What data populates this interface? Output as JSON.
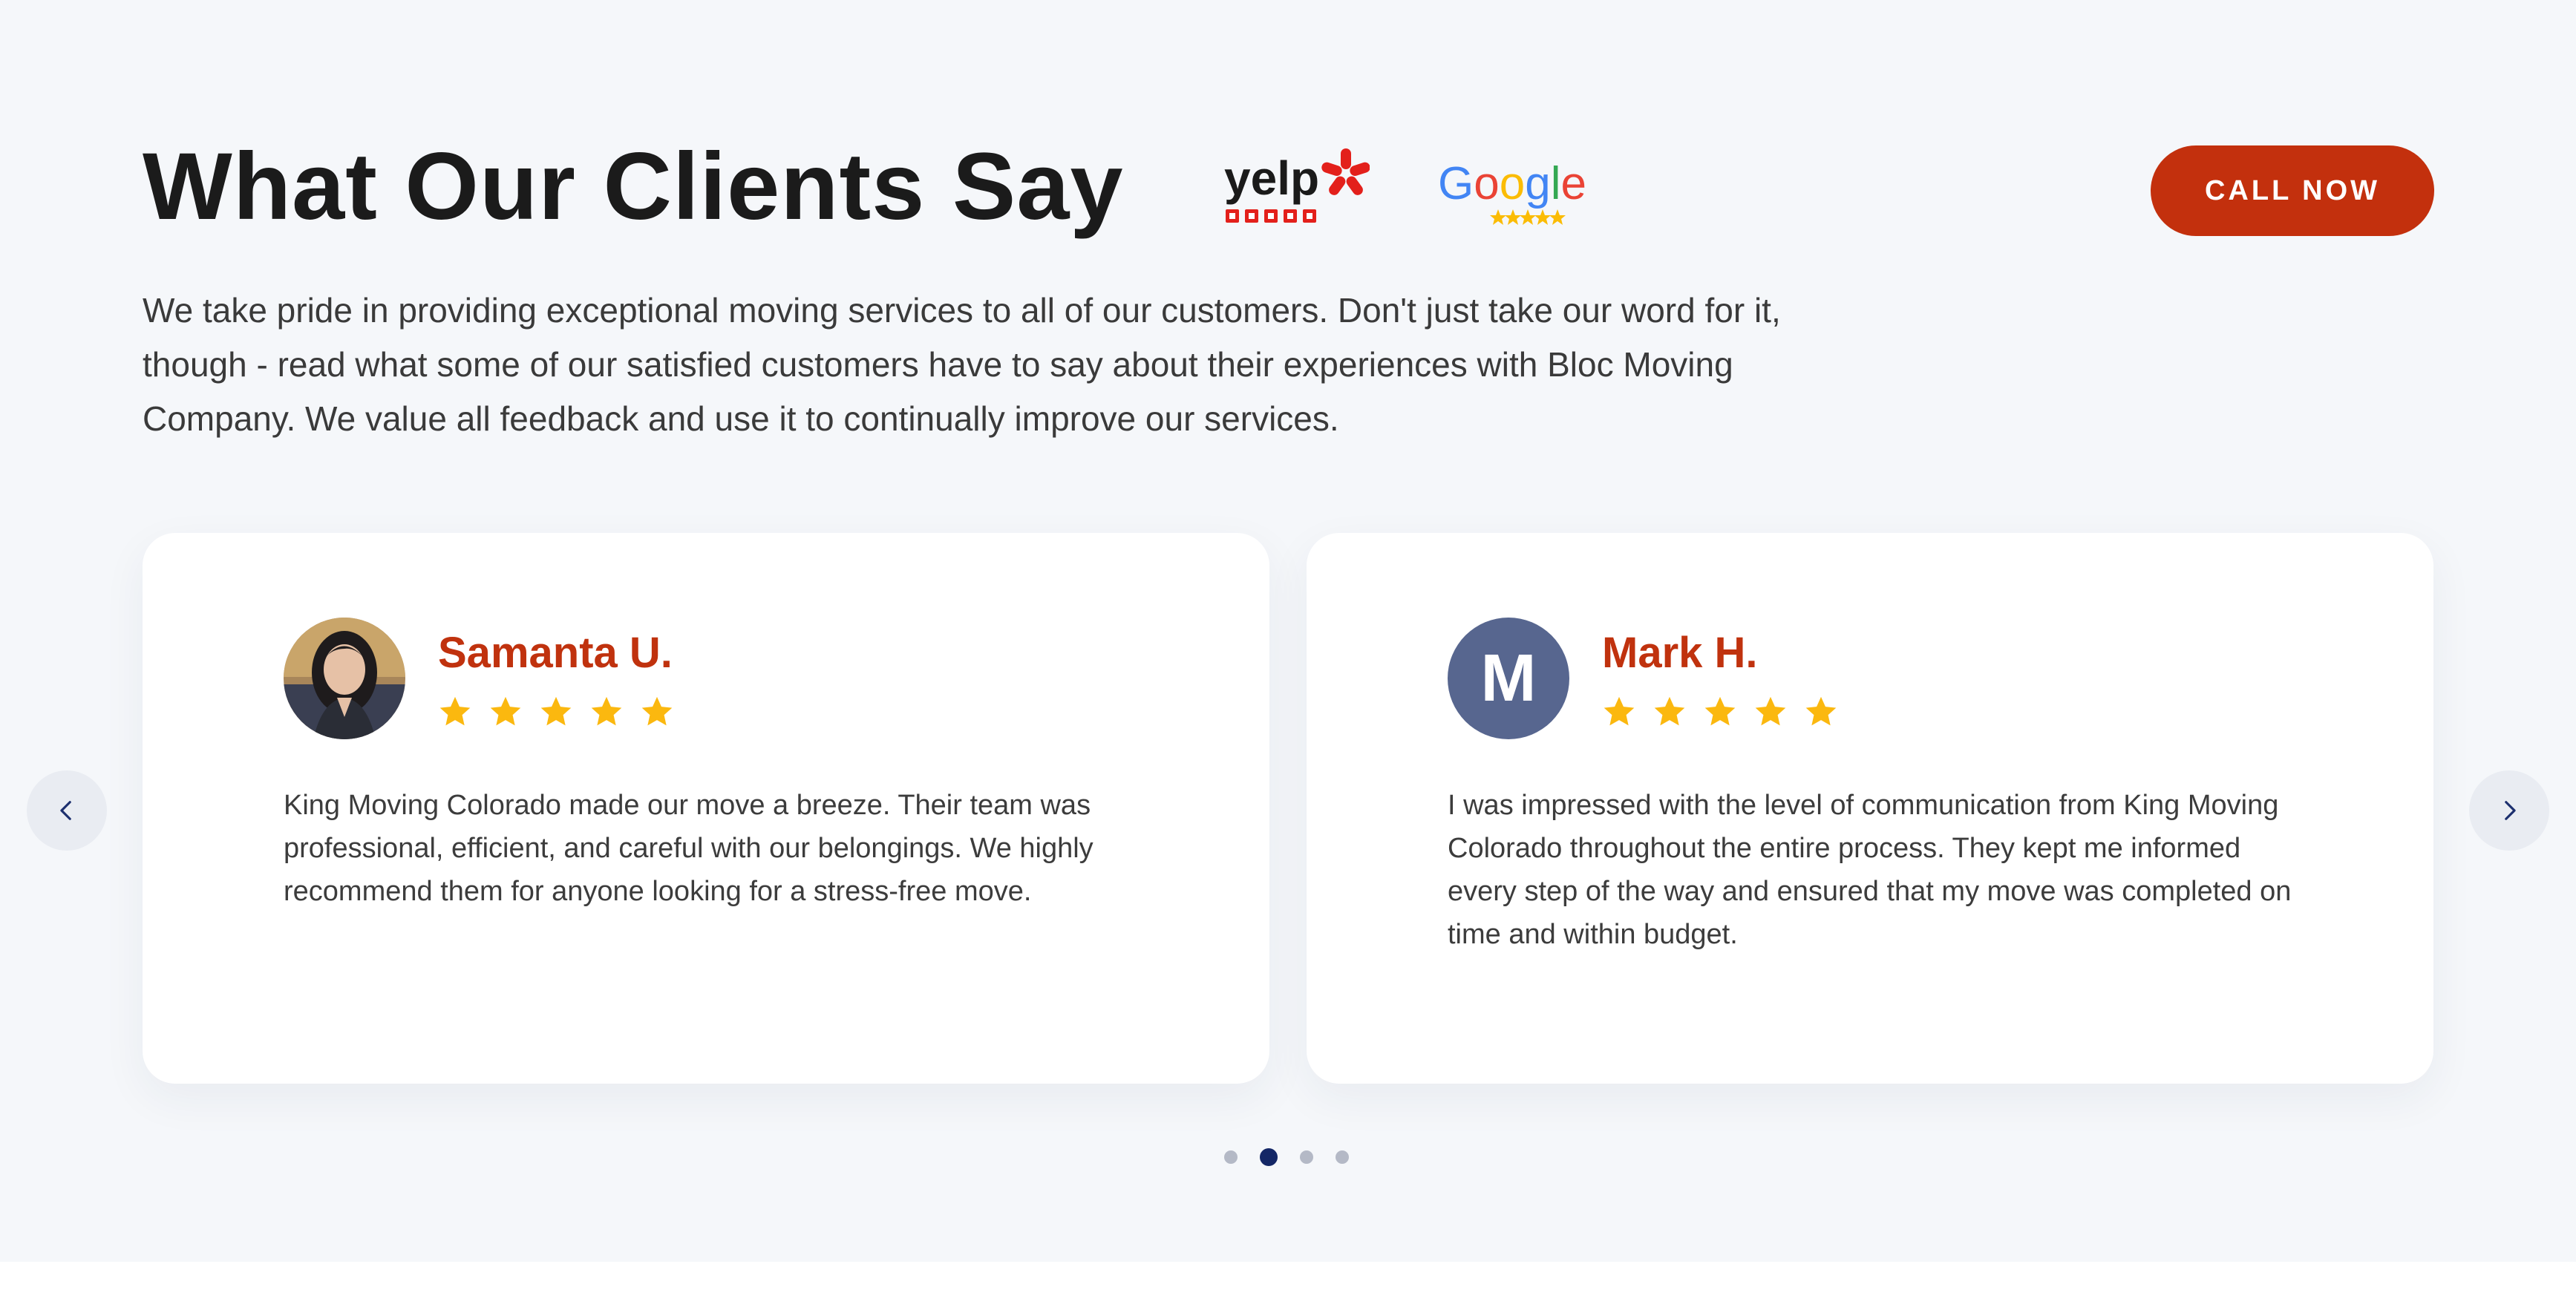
{
  "header": {
    "title": "What Our Clients Say",
    "call_button": "CALL NOW",
    "intro": "We take pride in providing exceptional moving services to all of our customers. Don't just take our word for it, though - read what some of our satisfied customers have to say about their experiences with Bloc Moving Company. We value all feedback and use it to continually improve our services."
  },
  "logos": {
    "yelp": "yelp",
    "google": "Google",
    "yelp_rating": 5,
    "google_rating": 5
  },
  "reviews": [
    {
      "name": "Samanta U.",
      "rating": 5,
      "avatar": "photo",
      "text": "King Moving Colorado made our move a breeze. Their team was professional, efficient, and careful with our belongings. We highly recommend them for anyone looking for a stress-free move."
    },
    {
      "name": "Mark H.",
      "rating": 5,
      "avatar_letter": "M",
      "text": "I was impressed with the level of communication from King Moving Colorado throughout the entire process. They kept me informed every step of the way and ensured that my move was completed on time and within budget."
    }
  ],
  "carousel": {
    "prev_icon": "chevron-left-icon",
    "next_icon": "chevron-right-icon",
    "page_count": 4,
    "active_page": 2
  },
  "colors": {
    "accent": "#c3300d",
    "star": "#fbb80f",
    "dot_active": "#142766",
    "avatar_bg": "#57668f",
    "section_bg": "#f5f7fa"
  }
}
